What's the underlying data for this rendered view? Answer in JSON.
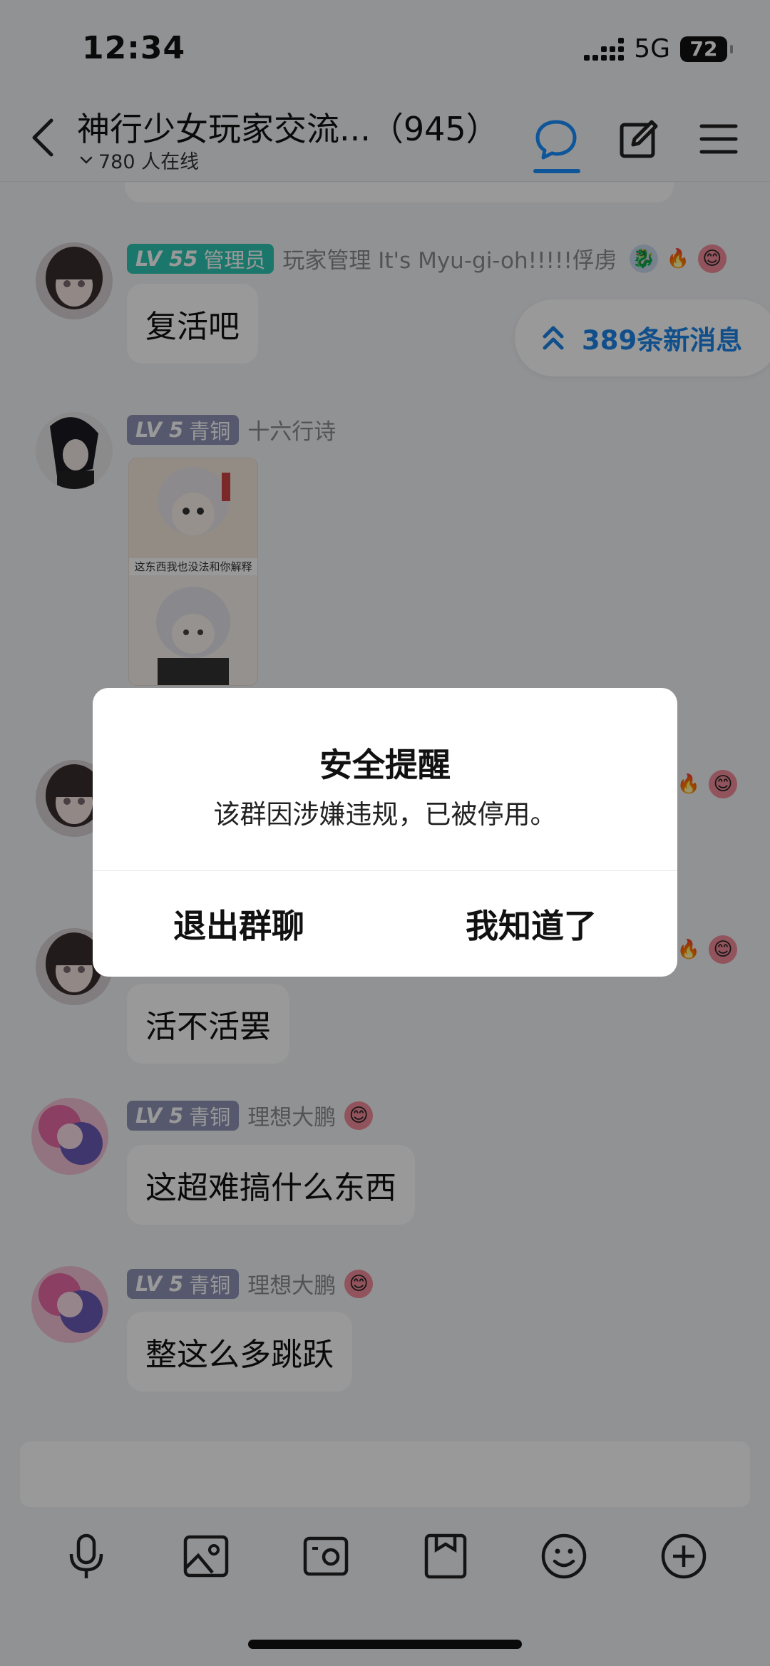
{
  "status_bar": {
    "time": "12:34",
    "network": "5G",
    "battery": "72"
  },
  "header": {
    "title": "神行少女玩家交流...（945）",
    "online_text": "780 人在线"
  },
  "new_messages": {
    "label": "389条新消息"
  },
  "messages": [
    {
      "level": "LV 55",
      "role": "管理员",
      "nickname": "玩家管理 It's Myu-gi-oh!!!!!俘虏",
      "text": "复活吧"
    },
    {
      "level": "LV 5",
      "role": "青铜",
      "nickname": "十六行诗",
      "sticker_caption": "这东西我也没法和你解释"
    },
    {
      "text": "活不活罢"
    },
    {
      "level": "LV 5",
      "role": "青铜",
      "nickname": "理想大鹏",
      "text": "这超难搞什么东西"
    },
    {
      "level": "LV 5",
      "role": "青铜",
      "nickname": "理想大鹏",
      "text": "整这么多跳跃"
    }
  ],
  "dialog": {
    "title": "安全提醒",
    "message": "该群因涉嫌违规，已被停用。",
    "exit_label": "退出群聊",
    "ok_label": "我知道了"
  },
  "colors": {
    "accent": "#1890ff",
    "admin_badge": "#2ec7b2",
    "bronze_badge": "#8f95b8"
  },
  "icons": [
    "back-icon",
    "chat-icon",
    "edit-icon",
    "menu-icon",
    "microphone-icon",
    "image-icon",
    "camera-icon",
    "file-icon",
    "emoji-icon",
    "plus-icon"
  ]
}
